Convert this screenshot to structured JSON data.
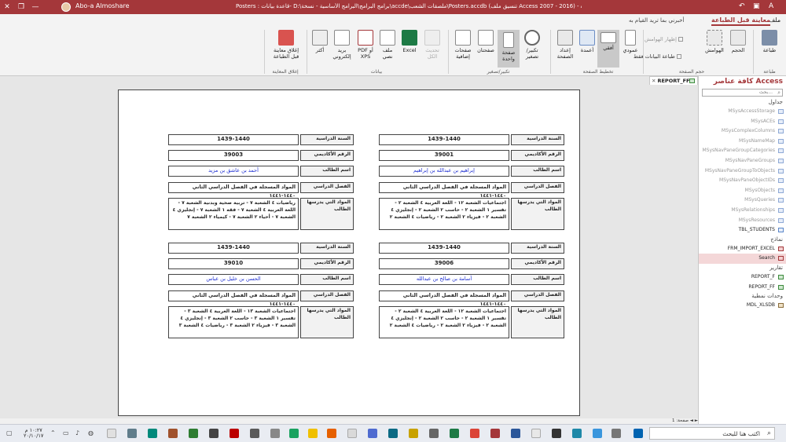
{
  "titlebar": {
    "title": "Posters : قاعدة بيانات- D:\\برامج البرامج\\البرامج الأساسية - نسخة\\accde\\ملصقات الشعب\\Posters.accdb (تنسيق ملف Access 2007 - 2016) - Access",
    "user": "Abo-a Almoshare"
  },
  "tabs": {
    "file": "ملف",
    "print_preview": "معاينة قبل الطباعة",
    "tell_me": "أخبرني بما تريد القيام به"
  },
  "ribbon": {
    "print": "طباعة",
    "size": "الحجم",
    "margins": "الهوامش",
    "show_margins": "إظهار الهوامش",
    "print_data_only": "طباعة البيانات فقط",
    "portrait": "عمودي",
    "landscape": "أفقي",
    "columns": "أعمدة",
    "page_setup": "إعداد الصفحة",
    "zoom": "تكبير/تصغير",
    "one_page": "صفحة واحدة",
    "two_pages": "صفحتان",
    "more_pages": "صفحات إضافية",
    "refresh_all": "تحديث الكل",
    "excel": "Excel",
    "text_file": "ملف نصي",
    "pdf_xps": "PDF أو XPS",
    "email": "بريد إلكتروني",
    "more": "أكثر",
    "close_preview": "إغلاق معاينة قبل الطباعة",
    "groups": {
      "print": "طباعة",
      "page_size": "حجم الصفحة",
      "page_layout": "تخطيط الصفحة",
      "zoom": "تكبير/تصغير",
      "data": "بيانات",
      "close_preview": "إغلاق المعاينة"
    }
  },
  "nav": {
    "title": "كافة عناصر Access",
    "search_placeholder": "بحث...",
    "sections": {
      "tables": "جداول",
      "forms": "نماذج",
      "reports": "تقارير",
      "modules": "وحدات نمطية"
    },
    "tables": [
      "MSysAccessStorage",
      "MSysACEs",
      "MSysComplexColumns",
      "MSysNameMap",
      "MSysNavPaneGroupCategories",
      "MSysNavPaneGroups",
      "MSysNavPaneGroupToObjects",
      "MSysNavPaneObjectIDs",
      "MSysObjects",
      "MSysQueries",
      "MSysRelationships",
      "MSysResources",
      "TBL_STUDENTS"
    ],
    "forms": [
      "FRM_IMPORT_EXCEL",
      "Search"
    ],
    "reports": [
      "REPORT_F",
      "REPORT_FF"
    ],
    "modules": [
      "MDL_XLSDB"
    ]
  },
  "doc_tab": "REPORT_FF",
  "labels": {
    "year": "السنة الدراسية",
    "id": "الرقم الأكاديمي",
    "name": "اسم الطالب",
    "semester": "الفصل الدراسي",
    "subjects": "المواد التي يدرسها الطالب"
  },
  "records": [
    {
      "year": "1439-1440",
      "id": "39001",
      "name": "إبراهيم بن عبدالله بن إبراهيم",
      "semester": "المواد المسجلة في الفصل الدراسي الثاني ١٤٤٠-١٤٤١",
      "subjects": "اجتماعيات الشعبة ١٢ - اللغة العربية ٤ الشعبة ٢ - تفسير ١ الشعبة ٢ - حاسب ٢ الشعبة ٢ - إنجليزي ٤ الشعبة ٢ - فيزياء ٢ الشعبة ٢ - رياضيات ٤ الشعبة ٢"
    },
    {
      "year": "1439-1440",
      "id": "39003",
      "name": "أحمد بن عاشق بن مزيد",
      "semester": "المواد المسجلة في الفصل الدراسي الثاني ١٤٤٠-١٤٤١",
      "subjects": "رياضيات ٤ الشعبة ٧ - تربية صحية وبدنية الشعبة ٧ - اللغة العربية ٤ الشعبة ٧ - فقه ١ الشعبة ٧ - إنجليزي ٤ الشعبة ٧ - أحياء ٢ الشعبة ٧ - كيمياء ٢ الشعبة ٧"
    },
    {
      "year": "1439-1440",
      "id": "39006",
      "name": "أسامة بن صالح بن عبدالله",
      "semester": "المواد المسجلة في الفصل الدراسي الثاني ١٤٤٠-١٤٤١",
      "subjects": "اجتماعيات الشعبة ١٢ - اللغة العربية ٤ الشعبة ٢ - تفسير ١ الشعبة ٢ - حاسب ٢ الشعبة ٢ - إنجليزي ٤ الشعبة ٢ - فيزياء ٢ الشعبة ٢ - رياضيات ٤ الشعبة ٢"
    },
    {
      "year": "1439-1440",
      "id": "39010",
      "name": "الحسن بن خليل بن عباس",
      "semester": "المواد المسجلة في الفصل الدراسي الثاني ١٤٤٠-١٤٤١",
      "subjects": "اجتماعيات الشعبة ١٣ - اللغة العربية ٤ الشعبة ٣ - تفسير ١ الشعبة ٣ - حاسب ٢ الشعبة ٣ - إنجليزي ٤ الشعبة ٣ - فيزياء ٢ الشعبة ٣ - رياضيات ٤ الشعبة ٣"
    }
  ],
  "status": {
    "page_nav": "صفحة: 1 ◄ ►"
  },
  "taskbar": {
    "search": "اكتب هنا للبحث",
    "time": "١٠:٢٧ م",
    "date": "٢٠/١٠/١٧"
  },
  "colors": {
    "brand": "#a4373a",
    "student_name": "#1a2bd0"
  }
}
